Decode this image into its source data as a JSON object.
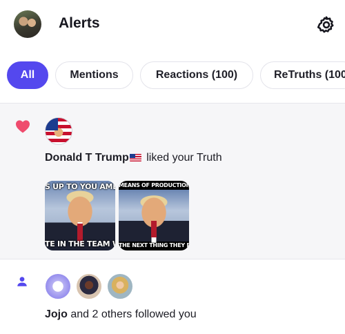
{
  "header": {
    "title": "Alerts",
    "avatar_icon": "user-avatar",
    "settings_icon": "gear-icon"
  },
  "tabs": [
    {
      "label": "All",
      "active": true
    },
    {
      "label": "Mentions",
      "active": false
    },
    {
      "label": "Reactions (100)",
      "active": false
    },
    {
      "label": "ReTruths (100",
      "active": false
    }
  ],
  "notifications": [
    {
      "icon": "heart-icon",
      "icon_color": "#ef4b6d",
      "user": "Donald T Trump",
      "action": "liked your Truth",
      "media": [
        {
          "caption_top": "S UP TO YOU AMERI",
          "caption_bottom": "TE IN THE TEAM WE"
        },
        {
          "caption_top": "MEANS OF PRODUCTION",
          "caption_bottom": "THE NEXT THING THEY DO?"
        }
      ]
    },
    {
      "icon": "person-icon",
      "icon_color": "#5448ee",
      "user": "Jojo",
      "action": "and 2 others followed you"
    }
  ],
  "colors": {
    "accent": "#5448ee",
    "highlight_bg": "#f6f6f8"
  }
}
